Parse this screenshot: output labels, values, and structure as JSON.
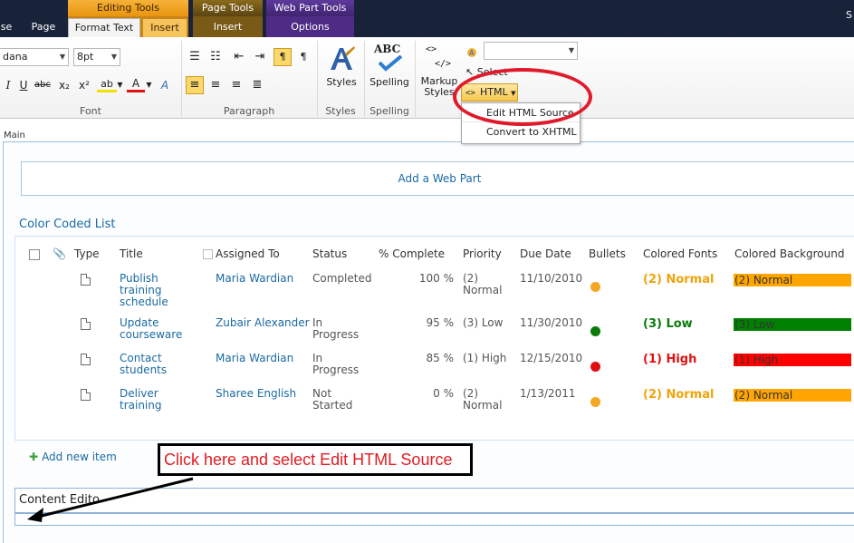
{
  "tabs": {
    "context": {
      "editing_tools": "Editing Tools",
      "page_tools": "Page Tools",
      "web_part_tools": "Web Part Tools"
    },
    "browse_partial": "se",
    "page": "Page",
    "format_text": "Format Text",
    "insert_editing": "Insert",
    "insert_page": "Insert",
    "options": "Options",
    "user_partial": "S"
  },
  "ribbon": {
    "font": {
      "label": "Font",
      "family_value": "dana",
      "size_value": "8pt",
      "buttons": [
        "I",
        "U",
        "abc",
        "x₂",
        "x²",
        "ab",
        "A",
        "A"
      ]
    },
    "paragraph": {
      "label": "Paragraph"
    },
    "styles": {
      "label": "Styles",
      "button": "Styles"
    },
    "spelling": {
      "label": "Spelling",
      "button": "Spelling",
      "icon_text": "ABC"
    },
    "markup": {
      "button_line1": "Markup",
      "button_line2": "Styles",
      "select_label": "Select",
      "html_button": "HTML",
      "html_icon": "<>",
      "markup_icon_top": "<>",
      "markup_icon_bottom": "</>",
      "menu": [
        "Edit HTML Source",
        "Convert to XHTML"
      ]
    }
  },
  "page": {
    "zone_label": "Main",
    "add_web_part": "Add a Web Part"
  },
  "list": {
    "title": "Color Coded List",
    "columns": [
      "Type",
      "Title",
      "Assigned To",
      "Status",
      "% Complete",
      "Priority",
      "Due Date",
      "Bullets",
      "Colored Fonts",
      "Colored Background"
    ],
    "rows": [
      {
        "title": [
          "Publish",
          "training",
          "schedule"
        ],
        "assigned": "Maria Wardian",
        "status": [
          "Completed"
        ],
        "complete": "100 %",
        "priority": [
          "(2)",
          "Normal"
        ],
        "due": "11/10/2010",
        "bullet_color": "#f5a623",
        "font_text": "(2) Normal",
        "font_color": "#f0a30a",
        "bg_text": "(2) Normal",
        "bg_color": "#ffa500"
      },
      {
        "title": [
          "Update",
          "courseware"
        ],
        "assigned": "Zubair Alexander",
        "status": [
          "In",
          "Progress"
        ],
        "complete": "95 %",
        "priority": [
          "(3) Low"
        ],
        "due": "11/30/2010",
        "bullet_color": "#0a7a0a",
        "font_text": "(3) Low",
        "font_color": "#0a7a0a",
        "bg_text": "(3) Low",
        "bg_color": "#008000"
      },
      {
        "title": [
          "Contact",
          "students"
        ],
        "assigned": "Maria Wardian",
        "status": [
          "In",
          "Progress"
        ],
        "complete": "85 %",
        "priority": [
          "(1) High"
        ],
        "due": "12/15/2010",
        "bullet_color": "#e01010",
        "font_text": "(1) High",
        "font_color": "#e01010",
        "bg_text": "(1) High",
        "bg_color": "#ff0000"
      },
      {
        "title": [
          "Deliver",
          "training"
        ],
        "assigned": "Sharee English",
        "status": [
          "Not",
          "Started"
        ],
        "complete": "0 %",
        "priority": [
          "(2)",
          "Normal"
        ],
        "due": "1/13/2011",
        "bullet_color": "#f5a623",
        "font_text": "(2) Normal",
        "font_color": "#f0a30a",
        "bg_text": "(2) Normal",
        "bg_color": "#ffa500"
      }
    ],
    "add_new": "Add new item"
  },
  "annotation": {
    "callout": "Click here and select Edit HTML Source"
  },
  "content_editor": {
    "title": "Content Edito"
  }
}
